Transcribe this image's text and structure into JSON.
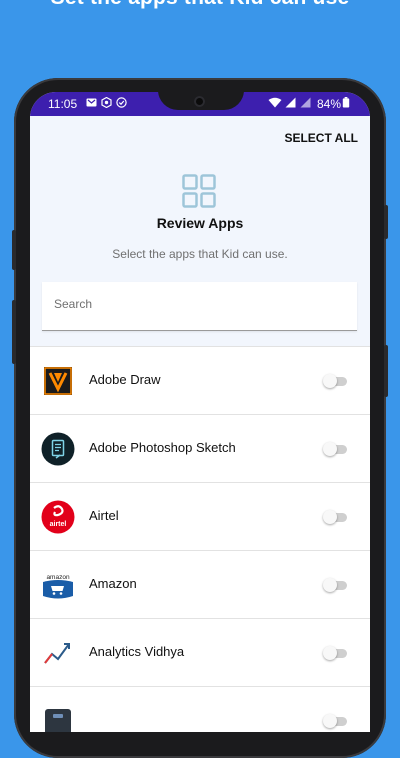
{
  "headline": "Set the apps that Kid can use",
  "status_bar": {
    "time": "11:05",
    "battery": "84%"
  },
  "header": {
    "select_all_label": "SELECT ALL",
    "title": "Review Apps",
    "subtitle": "Select the apps that Kid can use.",
    "icon": "apps-grid-icon"
  },
  "search": {
    "placeholder": "Search",
    "value": ""
  },
  "apps": [
    {
      "name": "Adobe Draw",
      "icon": "adobe-draw-icon",
      "enabled": false
    },
    {
      "name": "Adobe Photoshop Sketch",
      "icon": "adobe-photoshop-sketch-icon",
      "enabled": false
    },
    {
      "name": "Airtel",
      "icon": "airtel-icon",
      "enabled": false
    },
    {
      "name": "Amazon",
      "icon": "amazon-icon",
      "enabled": false
    },
    {
      "name": "Analytics Vidhya",
      "icon": "analytics-vidhya-icon",
      "enabled": false
    },
    {
      "name": "",
      "icon": "app-icon",
      "enabled": false
    }
  ],
  "airtel_icon_text": "airtel",
  "amazon_icon_text": "amazon",
  "colors": {
    "background": "#3a96ea",
    "status_bar": "#3d1fae",
    "header_bg": "#f2f6fd",
    "accent_grid": "#9ec5d9",
    "airtel_red": "#e2001a",
    "amazon_blue": "#1a5da8"
  }
}
